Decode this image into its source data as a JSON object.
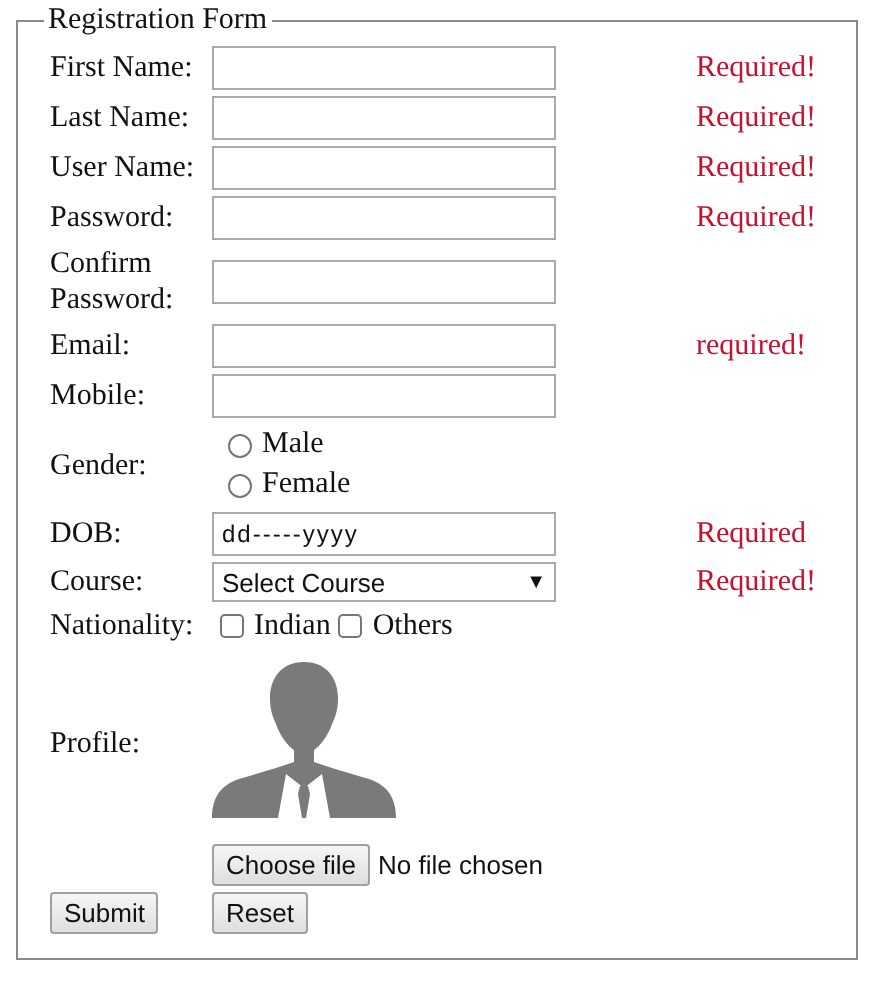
{
  "form": {
    "legend": "Registration Form",
    "fields": [
      {
        "kind": "text",
        "label": "First Name:",
        "error": "Required!"
      },
      {
        "kind": "text",
        "label": "Last Name:",
        "error": "Required!"
      },
      {
        "kind": "text",
        "label": "User Name:",
        "error": "Required!"
      },
      {
        "kind": "text",
        "label": "Password:",
        "error": "Required!"
      },
      {
        "kind": "text",
        "label": "Confirm Password:"
      },
      {
        "kind": "text",
        "label": "Email:",
        "error": "required!"
      },
      {
        "kind": "text",
        "label": "Mobile:"
      },
      {
        "kind": "radio",
        "label": "Gender:",
        "options": [
          {
            "label": "Male",
            "selected": false
          },
          {
            "label": "Female",
            "selected": false
          }
        ]
      },
      {
        "kind": "date",
        "label": "DOB:",
        "value": "dd-----yyyy",
        "error": "Required"
      },
      {
        "kind": "select",
        "label": "Course:",
        "value": "Select Course",
        "arrow": "▼",
        "error": "Required!"
      },
      {
        "kind": "checkbox",
        "label": "Nationality:",
        "options": [
          {
            "label": "Indian",
            "checked": false
          },
          {
            "label": "Others",
            "checked": false
          }
        ]
      },
      {
        "kind": "profile",
        "label": "Profile:",
        "file_button": "Choose file",
        "file_status": "No file chosen"
      }
    ],
    "buttons": [
      "Submit",
      "Reset"
    ]
  }
}
